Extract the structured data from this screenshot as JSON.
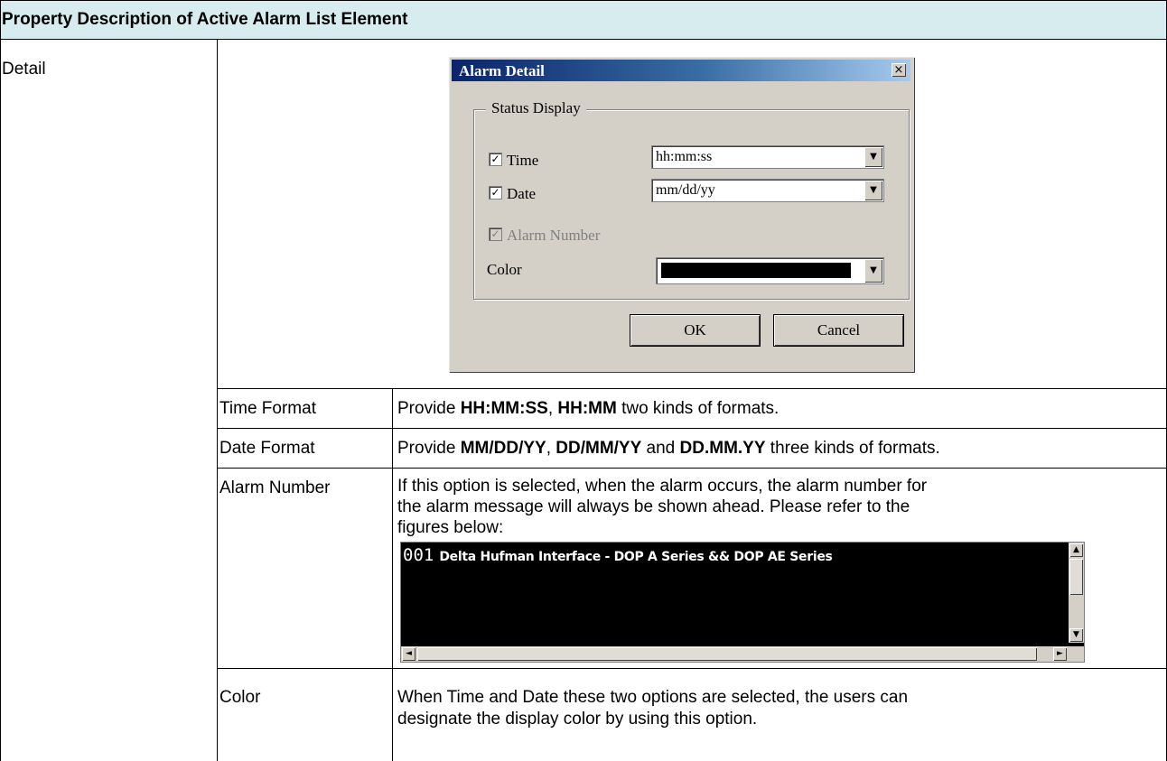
{
  "header": {
    "title": "Property Description of Active Alarm List Element"
  },
  "section": {
    "label": "Detail"
  },
  "dialog": {
    "title": "Alarm Detail",
    "close_glyph": "×",
    "group_label": "Status Display",
    "time": {
      "label": "Time",
      "checked": true,
      "value": "hh:mm:ss"
    },
    "date": {
      "label": "Date",
      "checked": true,
      "value": "mm/dd/yy"
    },
    "alarm_number": {
      "label": "Alarm Number",
      "checked": true,
      "disabled": true
    },
    "color": {
      "label": "Color",
      "value": "#000000"
    },
    "ok_label": "OK",
    "cancel_label": "Cancel"
  },
  "rows": [
    {
      "name": "Time Format",
      "desc_parts": [
        {
          "t": "Provide ",
          "b": false
        },
        {
          "t": "HH:MM:SS",
          "b": true
        },
        {
          "t": ", ",
          "b": false
        },
        {
          "t": "HH:MM",
          "b": true
        },
        {
          "t": " two kinds of formats.",
          "b": false
        }
      ]
    },
    {
      "name": "Date Format",
      "desc_parts": [
        {
          "t": "Provide ",
          "b": false
        },
        {
          "t": "MM/DD/YY",
          "b": true
        },
        {
          "t": ", ",
          "b": false
        },
        {
          "t": "DD/MM/YY",
          "b": true
        },
        {
          "t": " and ",
          "b": false
        },
        {
          "t": "DD.MM.YY",
          "b": true
        },
        {
          "t": " three kinds of formats.",
          "b": false
        }
      ]
    },
    {
      "name": "Alarm Number",
      "desc_lines": [
        "If this option is selected, when the alarm occurs, the alarm number for",
        "the alarm message will always be shown ahead. Please refer to the",
        "figures below:"
      ]
    },
    {
      "name": "Color",
      "desc_lines": [
        "When Time and Date these two options are selected, the users can",
        "designate the display color by using this option."
      ]
    }
  ],
  "preview": {
    "number": "001",
    "message": "Delta Hufman Interface - DOP A Series && DOP AE Series"
  },
  "icons": {
    "check": "✓",
    "dropdown": "▼",
    "up": "▲",
    "down": "▼",
    "left": "◄",
    "right": "►"
  }
}
